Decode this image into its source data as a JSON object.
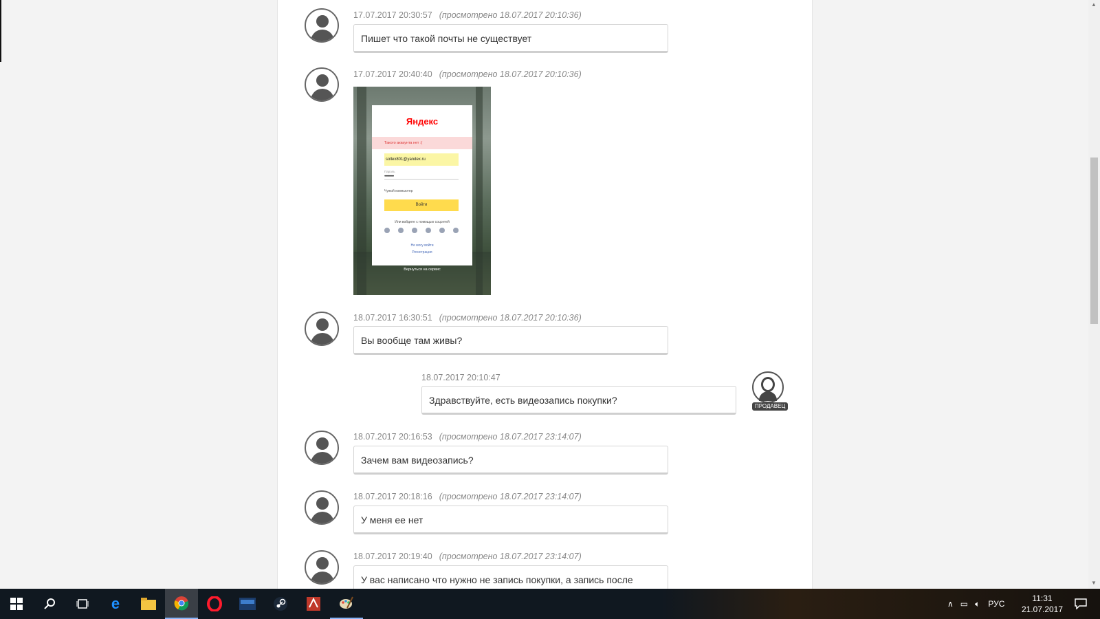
{
  "chat": {
    "messages": [
      {
        "time": "17.07.2017 20:30:57",
        "viewed": "(просмотрено 18.07.2017 20:10:36)",
        "text": "Пишет что такой почты не существует"
      },
      {
        "time": "17.07.2017 20:40:40",
        "viewed": "(просмотрено 18.07.2017 20:10:36)"
      },
      {
        "time": "18.07.2017 16:30:51",
        "viewed": "(просмотрено 18.07.2017 20:10:36)",
        "text": "Вы вообще там живы?"
      },
      {
        "time": "18.07.2017 20:10:47",
        "text": "Здравствуйте, есть видеозапись покупки?",
        "badge": "ПРОДАВЕЦ"
      },
      {
        "time": "18.07.2017 20:16:53",
        "viewed": "(просмотрено 18.07.2017 23:14:07)",
        "text": "Зачем вам видеозапись?"
      },
      {
        "time": "18.07.2017 20:18:16",
        "viewed": "(просмотрено 18.07.2017 23:14:07)",
        "text": "У меня ее нет"
      },
      {
        "time": "18.07.2017 20:19:40",
        "viewed": "(просмотрено 18.07.2017 23:14:07)",
        "text": "У вас написано что нужно не запись покупки, а запись после"
      }
    ]
  },
  "attachment": {
    "logo": "Яндекс",
    "error": "Такого аккаунта нет :(",
    "login": "sollex801@yandex.ru",
    "password_label": "Пароль",
    "password": "••••••••••••",
    "checkbox": "Чужой компьютер",
    "button": "Войти",
    "social_label": "Или войдите с помощью соцсетей",
    "link1": "Не могу войти",
    "link2": "Регистрация",
    "back": "Вернуться на сервис"
  },
  "taskbar": {
    "language": "РУС",
    "time": "11:31",
    "date": "21.07.2017",
    "icons": [
      "windows-start",
      "search",
      "task-view",
      "edge",
      "file-explorer",
      "chrome",
      "opera",
      "app",
      "steam",
      "app",
      "paint"
    ]
  },
  "colors": {
    "accent": "#8ab4f8",
    "bubble_border": "#d4d4d4",
    "meta_text": "#888888"
  }
}
